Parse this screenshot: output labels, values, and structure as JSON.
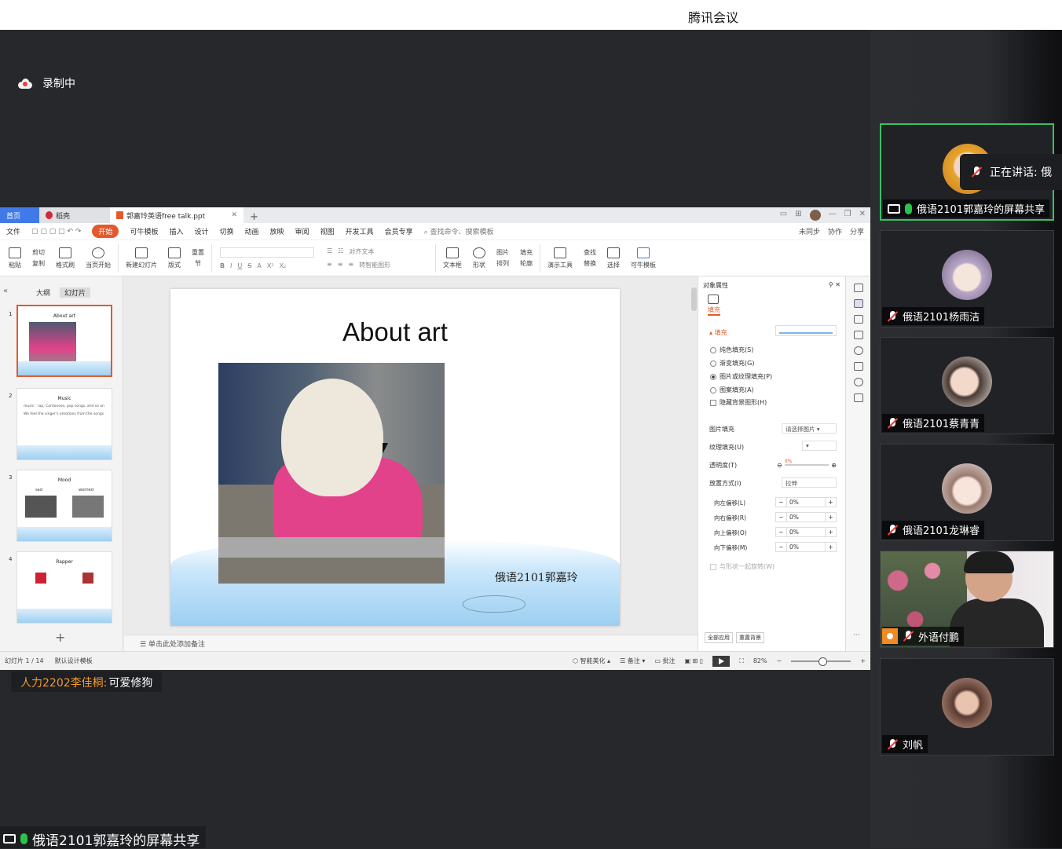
{
  "app_title": "腾讯会议",
  "recording": {
    "label": "录制中"
  },
  "wps": {
    "tabs": {
      "home": "首页",
      "daoke": "稻壳",
      "doc": "郭嘉玲英语free talk.ppt"
    },
    "menu": [
      "文件",
      "开始",
      "可牛模板",
      "插入",
      "设计",
      "切换",
      "动画",
      "放映",
      "审阅",
      "视图",
      "开发工具",
      "会员专享"
    ],
    "search": "查找命令、搜索模板",
    "menu_right": [
      "未同步",
      "协作",
      "分享"
    ],
    "ribbon": {
      "paste": "粘贴",
      "cut": "剪切",
      "copy": "复制",
      "format_painter": "格式刷",
      "current_start": "当页开始",
      "new_slide": "新建幻灯片",
      "layout": "版式",
      "reset": "重置",
      "section": "节",
      "text_box": "文本框",
      "shape": "形状",
      "picture": "图片",
      "arrange": "排列",
      "present_tools": "演示工具",
      "find": "查找",
      "replace": "替换",
      "select": "选择",
      "template": "可牛模板",
      "fill": "填充",
      "outline": "轮廓",
      "align_text": "对齐文本",
      "smart_shape": "转智能图形"
    },
    "left_panel": {
      "outline_tab": "大纲",
      "slides_tab": "幻灯片"
    },
    "thumbnails": [
      {
        "num": "1",
        "title": "About art"
      },
      {
        "num": "2",
        "title": "Music",
        "bullets": [
          "music：rap, Cantonese, pop songs, and so on",
          "We feel the singer's emotions from the songs"
        ]
      },
      {
        "num": "3",
        "title": "Mood",
        "sub": [
          "sad",
          "worried"
        ]
      },
      {
        "num": "4",
        "title": "Rapper"
      }
    ],
    "slide": {
      "title": "About art",
      "caption": "俄语2101郭嘉玲"
    },
    "notes_placeholder": "单击此处添加备注",
    "props": {
      "header": "对象属性",
      "tab_fill": "填充",
      "section_fill": "填充",
      "options": [
        "纯色填充(S)",
        "渐变填充(G)",
        "图片或纹理填充(P)",
        "图案填充(A)"
      ],
      "selected_option": "图片或纹理填充(P)",
      "hide_bg": "隐藏背景图形(H)",
      "picture_fill_label": "图片填充",
      "picture_fill_value": "请选择图片",
      "texture_label": "纹理填充(U)",
      "transparency_label": "透明度(T)",
      "transparency_value": "0%",
      "placement_label": "放置方式(I)",
      "placement_value": "拉伸",
      "offsets": [
        {
          "label": "向左偏移(L)",
          "value": "0%"
        },
        {
          "label": "向右偏移(R)",
          "value": "0%"
        },
        {
          "label": "向上偏移(O)",
          "value": "0%"
        },
        {
          "label": "向下偏移(M)",
          "value": "0%"
        }
      ],
      "rotate_with_shape": "与形状一起旋转(W)",
      "apply_all": "全部应用",
      "reset_bg": "重置背景"
    },
    "status": {
      "slide_count": "幻灯片 1 / 14",
      "template": "默认设计模板",
      "beautify": "智能美化",
      "notes": "备注",
      "comments": "批注",
      "zoom": "82%"
    }
  },
  "chat": {
    "sender": "人力2202李佳桐:",
    "message": "可爱修狗"
  },
  "share_label": "俄语2101郭嘉玲的屏幕共享",
  "speaking": {
    "label": "正在讲话: 俄"
  },
  "participants": [
    {
      "name": "俄语2101郭嘉玲的屏幕共享",
      "mic": "on",
      "active": true
    },
    {
      "name": "俄语2101杨雨洁",
      "mic": "off"
    },
    {
      "name": "俄语2101蔡青青",
      "mic": "off"
    },
    {
      "name": "俄语2101龙琳睿",
      "mic": "off"
    },
    {
      "name": "外语付鹏",
      "mic": "off",
      "video": true
    },
    {
      "name": "刘帆",
      "mic": "off"
    }
  ]
}
